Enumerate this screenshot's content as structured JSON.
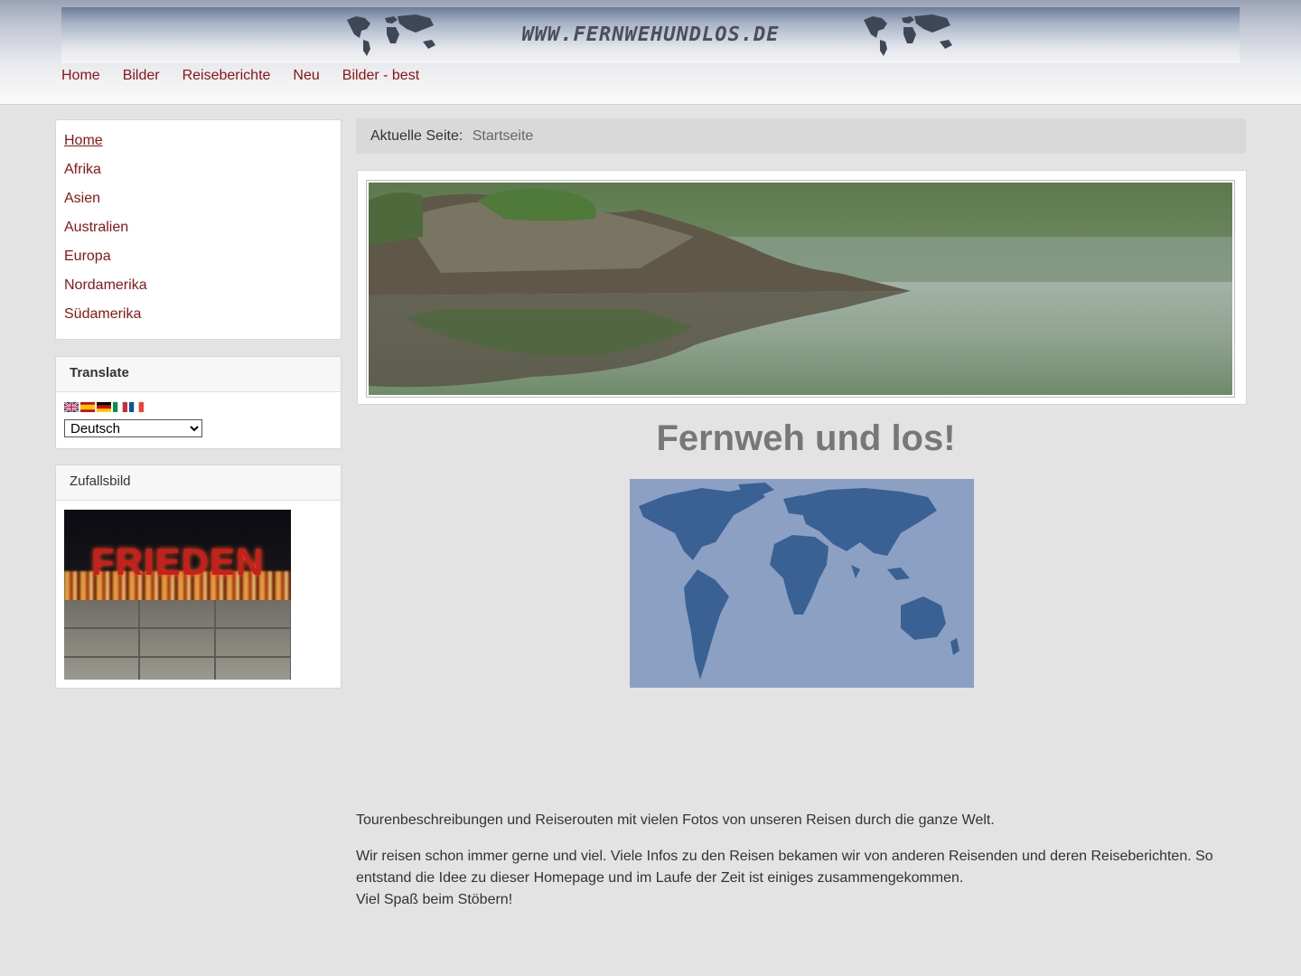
{
  "header": {
    "site_title": "WWW.FERNWEHUNDLOS.DE",
    "nav": [
      "Home",
      "Bilder",
      "Reiseberichte",
      "Neu",
      "Bilder - best"
    ]
  },
  "sidebar": {
    "menu": [
      "Home",
      "Afrika",
      "Asien",
      "Australien",
      "Europa",
      "Nordamerika",
      "Südamerika"
    ],
    "translate": {
      "title": "Translate",
      "flags": [
        "flag-uk-icon",
        "flag-es-icon",
        "flag-de-icon",
        "flag-it-icon",
        "flag-fr-icon"
      ],
      "selected_language": "Deutsch"
    },
    "random_image": {
      "title": "Zufallsbild",
      "image_text": "FRIEDEN"
    }
  },
  "breadcrumb": {
    "label": "Aktuelle Seite:",
    "current": "Startseite"
  },
  "main": {
    "title": "Fernweh und los!",
    "paragraph1": "Tourenbeschreibungen und Reiserouten mit vielen Fotos von unseren Reisen durch die ganze Welt.",
    "paragraph2_line1": "Wir reisen schon immer gerne und viel. Viele Infos zu den Reisen bekamen wir von anderen Reisenden und deren Reiseberichten. So entstand die Idee zu dieser Homepage und im Laufe der Zeit ist einiges zusammengekommen.",
    "paragraph2_line2": "Viel Spaß beim Stöbern!"
  },
  "colors": {
    "link": "#8b1414",
    "background": "#e3e3e3",
    "map_ocean": "#8ca0c3",
    "map_land": "#3a6194"
  }
}
